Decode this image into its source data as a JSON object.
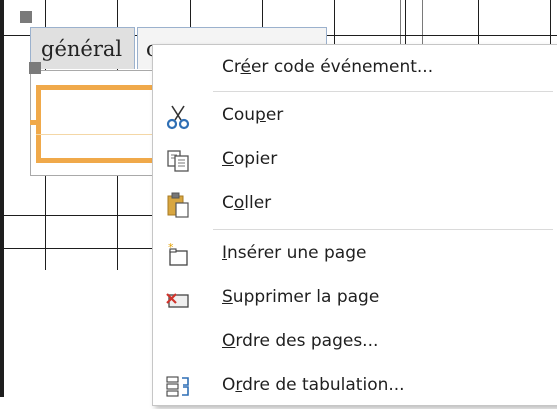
{
  "form": {
    "tab_active_label": "général",
    "tab_second_label": "c"
  },
  "context_menu": {
    "items": [
      {
        "label": "Créer code événement...",
        "underline": "r",
        "icon": "none"
      },
      {
        "label": "Couper",
        "underline": "p",
        "icon": "scissors-icon"
      },
      {
        "label": "Copier",
        "underline": "C",
        "icon": "copy-icon"
      },
      {
        "label": "Coller",
        "underline": "o",
        "icon": "paste-icon"
      },
      {
        "label": "Insérer une page",
        "underline": "I",
        "icon": "insert-page-icon"
      },
      {
        "label": "Supprimer la page",
        "underline": "S",
        "icon": "delete-page-icon"
      },
      {
        "label": "Ordre des pages...",
        "underline": "O",
        "icon": "none"
      },
      {
        "label": "Ordre de tabulation...",
        "underline": "r",
        "icon": "tab-order-icon"
      }
    ]
  },
  "colors": {
    "selection_accent": "#f0a94a",
    "scissors_blue": "#2f6fb5",
    "paste_gold": "#d8a640",
    "delete_red": "#d0342c"
  }
}
